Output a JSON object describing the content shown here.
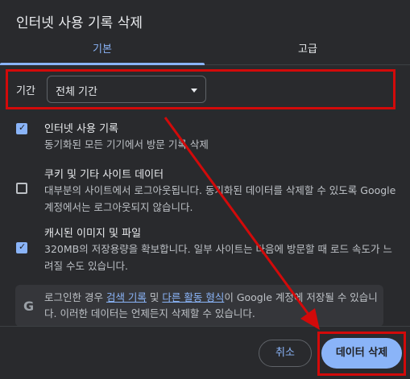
{
  "dialog": {
    "title": "인터넷 사용 기록 삭제",
    "tabs": [
      {
        "label": "기본",
        "selected": true
      },
      {
        "label": "고급",
        "selected": false
      }
    ],
    "period": {
      "label": "기간",
      "selected": "전체 기간"
    },
    "items": [
      {
        "title": "인터넷 사용 기록",
        "description": "동기화된 모든 기기에서 방문 기록 삭제",
        "checked": true
      },
      {
        "title": "쿠키 및 기타 사이트 데이터",
        "description": "대부분의 사이트에서 로그아웃됩니다. 동기화된 데이터를 삭제할 수 있도록 Google 계정에서는 로그아웃되지 않습니다.",
        "checked": false
      },
      {
        "title": "캐시된 이미지 및 파일",
        "description": "320MB의 저장용량을 확보합니다. 일부 사이트는 다음에 방문할 때 로드 속도가 느려질 수도 있습니다.",
        "checked": true
      }
    ],
    "info": {
      "icon": "G",
      "prefix": "로그인한 경우 ",
      "link1": "검색 기록",
      "mid": " 및 ",
      "link2": "다른 활동 형식",
      "suffix": "이 Google 계정에 저장될 수 있습니다. 이러한 데이터는 언제든지 삭제할 수 있습니다."
    },
    "buttons": {
      "cancel": "취소",
      "delete": "데이터 삭제"
    },
    "colors": {
      "accent": "#8ab4f8",
      "annotation": "#d20a0a",
      "background": "#292a2d"
    }
  }
}
